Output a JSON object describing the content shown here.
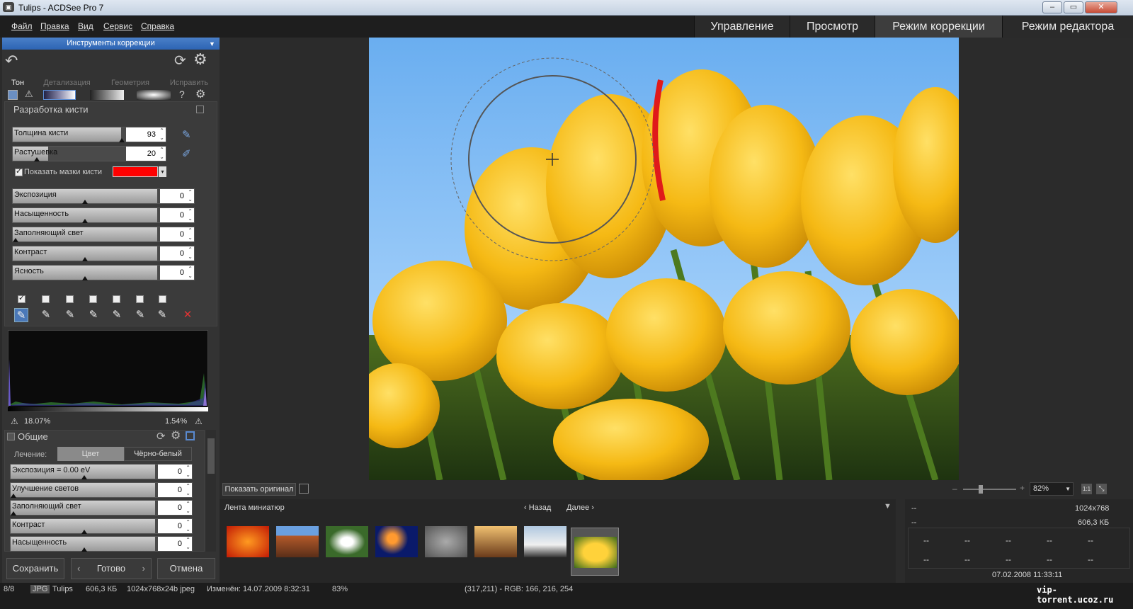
{
  "window": {
    "title": "Tulips - ACDSee Pro 7",
    "app_icon": "camera-icon",
    "min": "–",
    "max": "▭",
    "close": "✕"
  },
  "menu": [
    "Файл",
    "Правка",
    "Вид",
    "Сервис",
    "Справка"
  ],
  "modes": [
    "Управление",
    "Просмотр",
    "Режим коррекции",
    "Режим редактора"
  ],
  "left": {
    "header": "Инструменты коррекции",
    "tabs": [
      "Тон",
      "Детализация",
      "Геометрия",
      "Исправить"
    ],
    "brush_group": "Разработка кисти",
    "brush_width": {
      "label": "Толщина кисти",
      "value": "93"
    },
    "feather": {
      "label": "Растушевка",
      "value": "20"
    },
    "show_masks": "Показать мазки кисти",
    "mask_color": "#ff0000",
    "sliders": [
      {
        "label": "Экспозиция",
        "value": "0"
      },
      {
        "label": "Насыщенность",
        "value": "0"
      },
      {
        "label": "Заполняющий свет",
        "value": "0"
      },
      {
        "label": "Контраст",
        "value": "0"
      },
      {
        "label": "Ясность",
        "value": "0"
      }
    ],
    "hist_left": "18.07%",
    "hist_right": "1.54%",
    "general": "Общие",
    "treatment_label": "Лечение:",
    "treatment_options": [
      "Цвет",
      "Чёрно-белый"
    ],
    "general_sliders": [
      {
        "label": "Экспозиция = 0.00 eV",
        "value": "0"
      },
      {
        "label": "Улучшение светов",
        "value": "0"
      },
      {
        "label": "Заполняющий свет",
        "value": "0"
      },
      {
        "label": "Контраст",
        "value": "0"
      },
      {
        "label": "Насыщенность",
        "value": "0"
      }
    ],
    "save": "Сохранить",
    "done": "Готово",
    "cancel": "Отмена"
  },
  "viewbar": {
    "show_original": "Показать оригинал",
    "zoom": "82%"
  },
  "filmstrip": {
    "title": "Лента миниатюр",
    "back": "Назад",
    "next": "Далее"
  },
  "info": {
    "dims": "1024x768",
    "size": "606,3 КБ",
    "date": "07.02.2008 11:33:11",
    "dash": "--"
  },
  "status": {
    "count": "8/8",
    "type": "JPG",
    "name": "Tulips",
    "filesize": "606,3 КБ",
    "format": "1024x768x24b jpeg",
    "modified": "Изменён: 14.07.2009 8:32:31",
    "zoom": "83%",
    "pixel": "(317,211) - RGB: 166, 216, 254"
  },
  "watermark": "vip-torrent.ucoz.ru"
}
